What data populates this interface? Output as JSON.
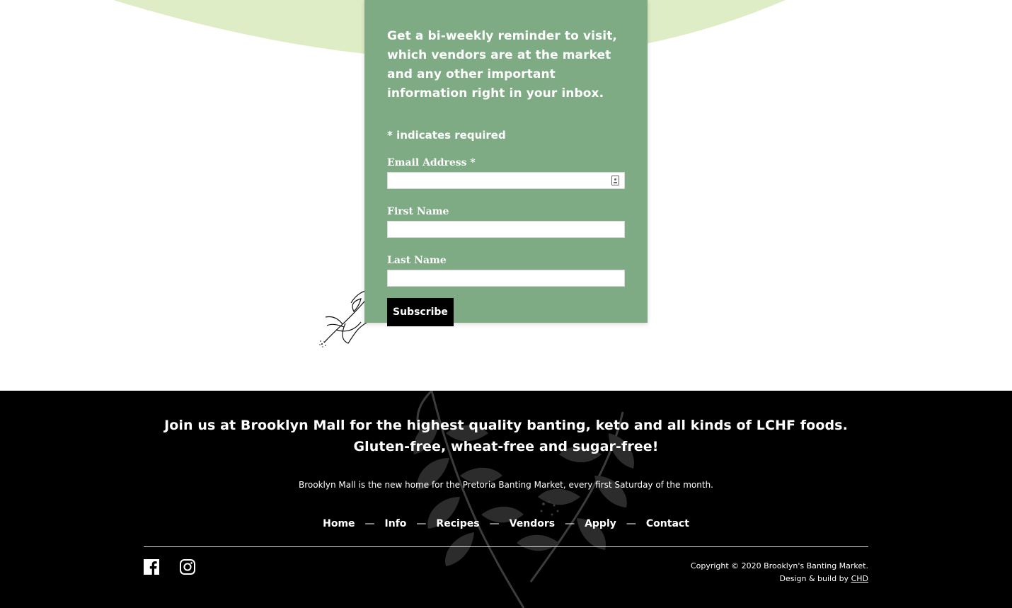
{
  "signup": {
    "intro": "Get a bi-weekly reminder to visit, which vendors are at the market and any other important information right in your inbox.",
    "required_note": "* indicates required",
    "email_label": "Email Address *",
    "email_value": "",
    "first_name_label": "First Name",
    "first_name_value": "",
    "last_name_label": "Last Name",
    "last_name_value": "",
    "subscribe_label": "Subscribe"
  },
  "footer": {
    "tagline": "Join us at Brooklyn Mall for the highest quality banting, keto and all kinds of LCHF foods. Gluten-free, wheat-free and sugar-free!",
    "subtext": "Brooklyn Mall is the new home for the Pretoria Banting Market, every first Saturday of the month.",
    "nav": [
      "Home",
      "Info",
      "Recipes",
      "Vendors",
      "Apply",
      "Contact"
    ],
    "separator": "—",
    "social_icons": [
      "facebook-icon",
      "instagram-icon"
    ],
    "copyright": "Copyright © 2020 Brooklyn's Banting Market.",
    "credit_prefix": "Design & build by",
    "credit_link": "CHD"
  },
  "colors": {
    "card_green": "#7eab83",
    "blob_green": "#deedc6",
    "footer_bg": "#000000"
  }
}
